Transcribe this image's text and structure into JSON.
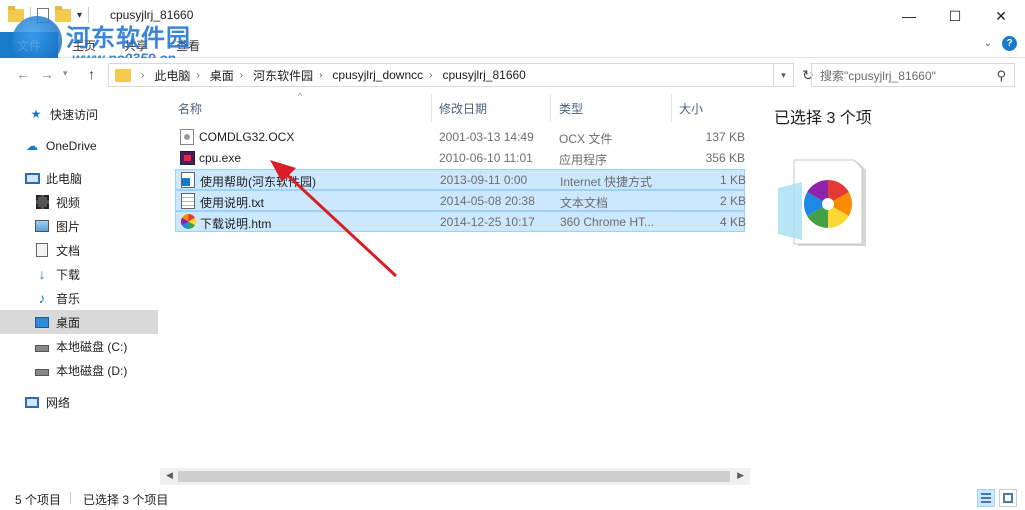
{
  "window": {
    "title": "cpusyjlrj_81660",
    "minimize": "—",
    "maximize": "☐",
    "close": "✕"
  },
  "ribbon": {
    "file_tab": "文件",
    "tabs": [
      "主页",
      "共享",
      "查看"
    ]
  },
  "watermark": {
    "text": "河东软件园",
    "url": "www.pc0359.cn"
  },
  "address": {
    "crumbs": [
      "此电脑",
      "桌面",
      "河东软件园",
      "cpusyjlrj_downcc",
      "cpusyjlrj_81660"
    ]
  },
  "search": {
    "placeholder": "搜索\"cpusyjlrj_81660\""
  },
  "sidebar": {
    "items": [
      {
        "label": "快速访问",
        "icon": "star-icon"
      },
      {
        "label": "OneDrive",
        "icon": "cloud-icon"
      },
      {
        "label": "此电脑",
        "icon": "computer-icon"
      },
      {
        "label": "视频",
        "icon": "video-icon"
      },
      {
        "label": "图片",
        "icon": "picture-icon"
      },
      {
        "label": "文档",
        "icon": "document-icon"
      },
      {
        "label": "下载",
        "icon": "download-icon"
      },
      {
        "label": "音乐",
        "icon": "music-icon"
      },
      {
        "label": "桌面",
        "icon": "desktop-icon"
      },
      {
        "label": "本地磁盘 (C:)",
        "icon": "drive-icon"
      },
      {
        "label": "本地磁盘 (D:)",
        "icon": "drive-icon"
      },
      {
        "label": "网络",
        "icon": "network-icon"
      }
    ],
    "selected": "桌面"
  },
  "columns": {
    "name": "名称",
    "date": "修改日期",
    "type": "类型",
    "size": "大小"
  },
  "files": [
    {
      "name": "COMDLG32.OCX",
      "date": "2001-03-13 14:49",
      "type": "OCX 文件",
      "size": "137 KB",
      "selected": false,
      "icon": "ocx-file-icon"
    },
    {
      "name": "cpu.exe",
      "date": "2010-06-10 11:01",
      "type": "应用程序",
      "size": "356 KB",
      "selected": false,
      "icon": "exe-file-icon"
    },
    {
      "name": "使用帮助(河东软件园)",
      "date": "2013-09-11 0:00",
      "type": "Internet 快捷方式",
      "size": "1 KB",
      "selected": true,
      "icon": "shortcut-file-icon"
    },
    {
      "name": "使用说明.txt",
      "date": "2014-05-08 20:38",
      "type": "文本文档",
      "size": "2 KB",
      "selected": true,
      "icon": "text-file-icon"
    },
    {
      "name": "下载说明.htm",
      "date": "2014-12-25 10:17",
      "type": "360 Chrome HT...",
      "size": "4 KB",
      "selected": true,
      "icon": "html-file-icon"
    }
  ],
  "preview": {
    "title": "已选择 3 个项"
  },
  "status": {
    "count": "5 个项目",
    "selected": "已选择 3 个项目"
  },
  "colors": {
    "accent": "#1979ca",
    "selection_bg": "#cce8ff",
    "selection_border": "#99d1ff",
    "arrow": "#d91f26"
  }
}
